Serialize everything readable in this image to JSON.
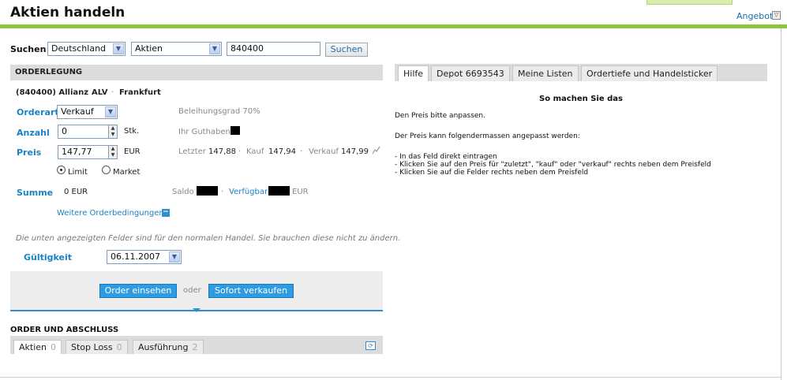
{
  "header": {
    "title": "Aktien handeln",
    "angebot_label": "Angebot",
    "angebot_toggle": "▽"
  },
  "search": {
    "label": "Suchen",
    "country": "Deutschland",
    "type": "Aktien",
    "query": "840400",
    "button": "Suchen"
  },
  "order": {
    "section_title": "ORDERLEGUNG",
    "instrument": "(840400) Allianz",
    "symbol": "ALV",
    "exchange": "Frankfurt",
    "sep": "·",
    "orderart_label": "Orderart",
    "orderart_value": "Verkauf",
    "beleihung": "Beleihungsgrad 70%",
    "anzahl_label": "Anzahl",
    "anzahl_value": "0",
    "stk": "Stk.",
    "guthaben_label": "Ihr Guthaben",
    "preis_label": "Preis",
    "preis_value": "147,77",
    "currency": "EUR",
    "letzter_label": "Letzter",
    "letzter_value": "147,88",
    "kauf_label": "Kauf",
    "kauf_value": "147,94",
    "verkauf_label": "Verkauf",
    "verkauf_value": "147,99",
    "limit_label": "Limit",
    "market_label": "Market",
    "selected_type": "Limit",
    "summe_label": "Summe",
    "summe_value": "0 EUR",
    "saldo_label": "Saldo",
    "verfuegbar_label": "Verfügbar",
    "verfuegbar_currency": "EUR",
    "weitere_label": "Weitere Orderbedingungen",
    "weitere_toggle": "−",
    "note": "Die unten angezeigten Felder sind für den normalen Handel. Sie brauchen diese nicht zu ändern.",
    "gueltigkeit_label": "Gültigkeit",
    "gueltigkeit_value": "06.11.2007",
    "btn_einsehen": "Order einsehen",
    "oder": "oder",
    "btn_verkaufen": "Sofort verkaufen"
  },
  "abschluss": {
    "title": "ORDER UND ABSCHLUSS",
    "tabs": [
      {
        "label": "Aktien",
        "count": "0"
      },
      {
        "label": "Stop Loss",
        "count": "0"
      },
      {
        "label": "Ausführung",
        "count": "2"
      }
    ],
    "refresh_icon": "⟳"
  },
  "right": {
    "tabs": [
      "Hilfe",
      "Depot 6693543",
      "Meine Listen",
      "Ordertiefe und Handelsticker"
    ],
    "help_title": "So machen Sie das",
    "line1": "Den Preis bitte anpassen.",
    "line2": "Der Preis kann folgendermassen angepasst werden:",
    "bullet1": "- In das Feld direkt eintragen",
    "bullet2": "- Klicken Sie auf den Preis für \"zuletzt\", \"kauf\" oder \"verkauf\" rechts neben dem Preisfeld",
    "bullet3": "- Klicken Sie auf die Felder rechts neben dem Preisfeld"
  },
  "icons": {
    "dropdown": "chevron-down-icon",
    "chart": "chart-icon",
    "refresh": "refresh-icon"
  },
  "colors": {
    "accent_green": "#8cc63f",
    "link_blue": "#1a82c4",
    "button_blue": "#2f9be0"
  }
}
